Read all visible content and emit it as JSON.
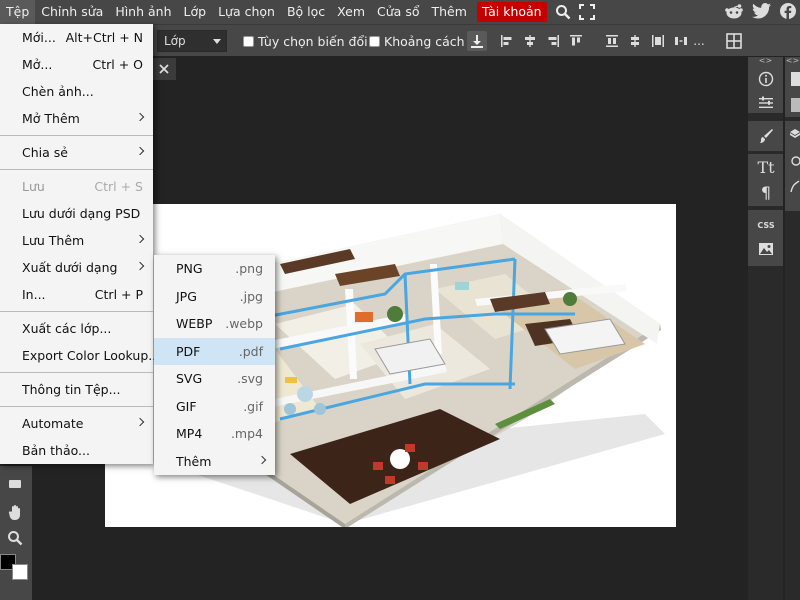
{
  "menubar": {
    "items": [
      "Tệp",
      "Chỉnh sửa",
      "Hình ảnh",
      "Lớp",
      "Lựa chọn",
      "Bộ lọc",
      "Xem",
      "Cửa sổ",
      "Thêm"
    ],
    "account": "Tài khoản",
    "icons": [
      "search-icon",
      "fullscreen-icon",
      "reddit-icon",
      "twitter-icon",
      "facebook-icon"
    ]
  },
  "optionsbar": {
    "select_value": "Lớp",
    "checkbox_transform": "Tùy chọn biến đổi",
    "checkbox_distance": "Khoảng cách",
    "more": "..."
  },
  "file_menu": {
    "new": "Mới...",
    "new_sc": "Alt+Ctrl + N",
    "open": "Mở...",
    "open_sc": "Ctrl + O",
    "insert": "Chèn ảnh...",
    "open_more": "Mở Thêm",
    "share": "Chia sẻ",
    "save": "Lưu",
    "save_sc": "Ctrl + S",
    "save_psd": "Lưu dưới dạng PSD",
    "save_more": "Lưu Thêm",
    "export_as": "Xuất dưới dạng",
    "print": "In...",
    "print_sc": "Ctrl + P",
    "export_layers": "Xuất các lớp...",
    "export_color": "Export Color Lookup...",
    "file_info": "Thông tin Tệp...",
    "automate": "Automate",
    "drafts": "Bản thảo..."
  },
  "export_menu": {
    "items": [
      {
        "label": "PNG",
        "ext": ".png"
      },
      {
        "label": "JPG",
        "ext": ".jpg"
      },
      {
        "label": "WEBP",
        "ext": ".webp"
      },
      {
        "label": "PDF",
        "ext": ".pdf"
      },
      {
        "label": "SVG",
        "ext": ".svg"
      },
      {
        "label": "GIF",
        "ext": ".gif"
      },
      {
        "label": "MP4",
        "ext": ".mp4"
      },
      {
        "label": "Thêm",
        "ext": ""
      }
    ],
    "highlighted": "PDF"
  },
  "right_panel": {
    "collapse_label": "<>",
    "text_icon": "Tt",
    "para_icon": "¶",
    "css_icon": "CSS"
  },
  "colors": {
    "ui_bg": "#474747",
    "workspace": "#232323",
    "accent_account": "#c50000",
    "menu_bg": "#f4f4f4",
    "menu_hover": "#cfe4f5"
  }
}
